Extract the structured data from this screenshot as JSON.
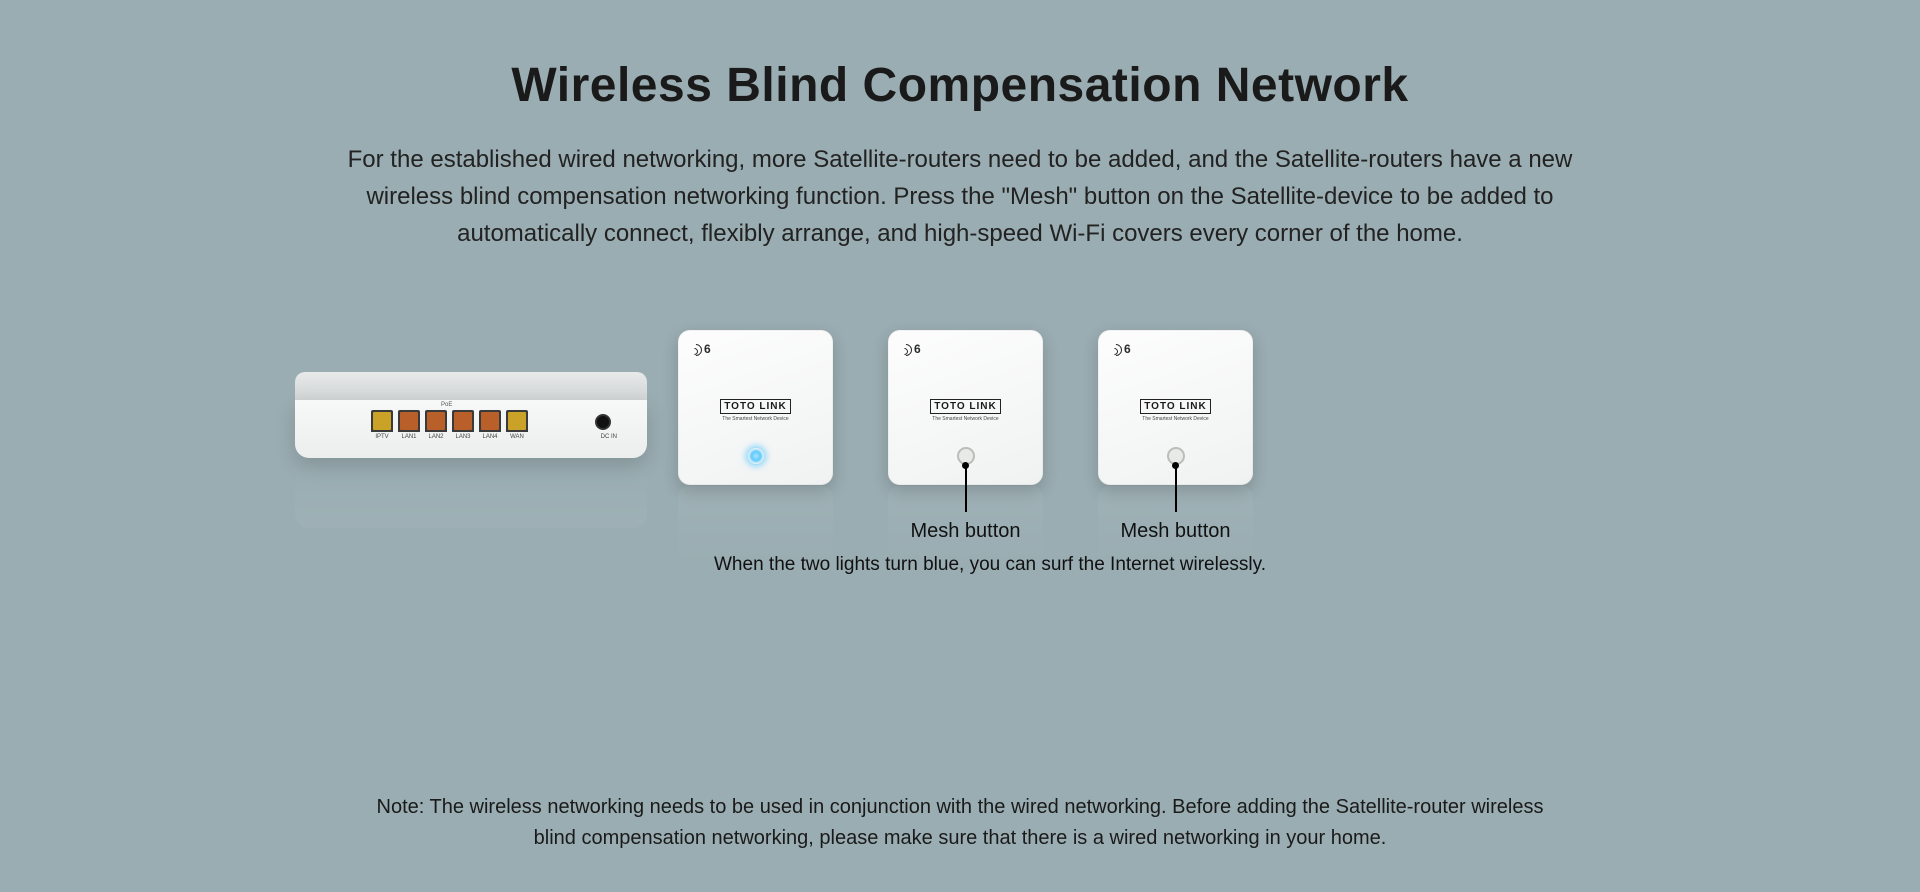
{
  "heading": "Wireless Blind Compensation Network",
  "subtext": "For the established wired networking, more Satellite-routers need to be added, and the Satellite-routers have a new wireless blind compensation networking function. Press the \"Mesh\" button on the Satellite-device to be added to automatically connect, flexibly arrange, and high-speed Wi-Fi covers every corner of the home.",
  "router": {
    "brand": "TOTO LINK",
    "poe_label": "PoE",
    "ports": [
      "IPTV",
      "LAN1",
      "LAN2",
      "LAN3",
      "LAN4",
      "WAN"
    ],
    "dc_label": "DC IN"
  },
  "satellite": {
    "wifi_badge": "6",
    "brand": "TOTO LINK",
    "tagline": "The Smartest Network Device"
  },
  "mesh_label": "Mesh button",
  "surf_text": "When the two lights turn blue, you can surf the Internet wirelessly.",
  "note": "Note: The wireless networking needs to be used in conjunction with the wired networking. Before adding the Satellite-router wireless blind compensation networking, please make sure that there is a wired networking in your home."
}
